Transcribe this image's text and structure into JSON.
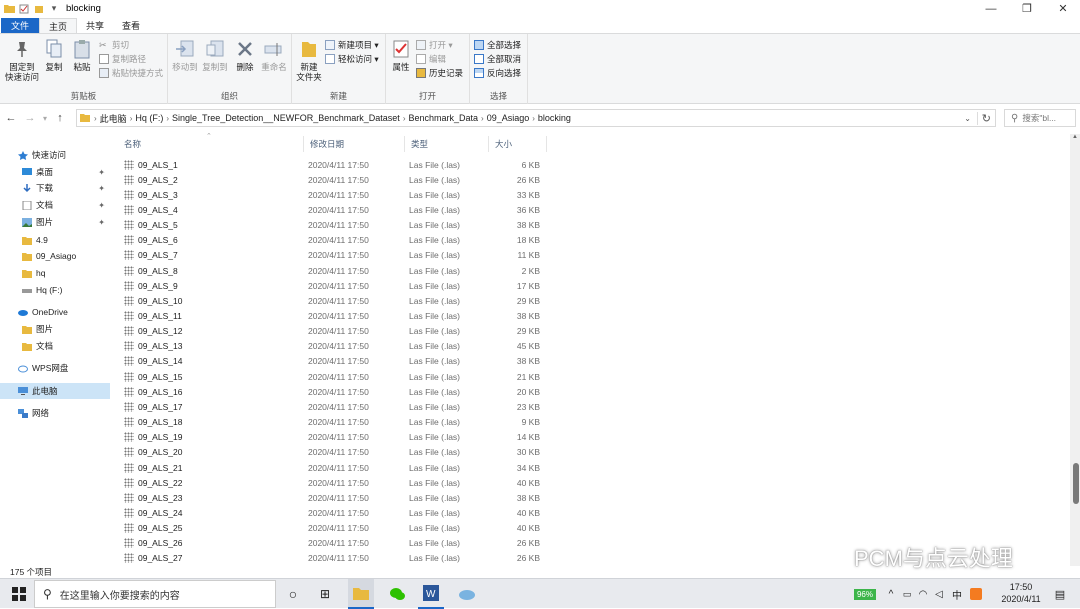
{
  "window": {
    "title": "blocking",
    "controls": {
      "minimize": "—",
      "maximize": "❐",
      "close": "✕"
    }
  },
  "tabs": [
    "文件",
    "主页",
    "共享",
    "查看"
  ],
  "ribbon": {
    "clipboard": {
      "label": "剪贴板",
      "pin": "固定到\n快速访问",
      "copy": "复制",
      "paste": "粘贴",
      "cut": "剪切",
      "copy_path": "复制路径",
      "paste_shortcut": "粘贴快捷方式"
    },
    "organize": {
      "label": "组织",
      "move_to": "移动到",
      "copy_to": "复制到",
      "delete": "删除",
      "rename": "重命名"
    },
    "new": {
      "label": "新建",
      "new_folder": "新建\n文件夹",
      "new_item": "新建项目 ▾",
      "easy_access": "轻松访问 ▾"
    },
    "open": {
      "label": "打开",
      "properties": "属性",
      "open": "打开 ▾",
      "edit": "编辑",
      "history": "历史记录"
    },
    "select": {
      "label": "选择",
      "select_all": "全部选择",
      "select_none": "全部取消",
      "invert": "反向选择"
    }
  },
  "address": {
    "crumbs": [
      "此电脑",
      "Hq (F:)",
      "Single_Tree_Detection__NEWFOR_Benchmark_Dataset",
      "Benchmark_Data",
      "09_Asiago",
      "blocking"
    ],
    "search_placeholder": "搜索\"bl..."
  },
  "nav": [
    {
      "label": "快速访问",
      "icon": "star-icon",
      "pinned": false
    },
    {
      "label": "桌面",
      "icon": "desktop-icon",
      "pinned": true
    },
    {
      "label": "下载",
      "icon": "download-icon",
      "pinned": true
    },
    {
      "label": "文档",
      "icon": "document-icon",
      "pinned": true
    },
    {
      "label": "图片",
      "icon": "picture-icon",
      "pinned": true
    },
    {
      "label": "4.9",
      "icon": "folder-icon",
      "pinned": false
    },
    {
      "label": "09_Asiago",
      "icon": "folder-icon",
      "pinned": false
    },
    {
      "label": "hq",
      "icon": "folder-icon",
      "pinned": false
    },
    {
      "label": "Hq (F:)",
      "icon": "drive-icon",
      "pinned": false
    },
    {
      "label": "OneDrive",
      "icon": "cloud-icon",
      "pinned": false
    },
    {
      "label": "图片",
      "icon": "folder-icon",
      "pinned": false
    },
    {
      "label": "文档",
      "icon": "folder-icon",
      "pinned": false
    },
    {
      "label": "WPS网盘",
      "icon": "wps-cloud-icon",
      "pinned": false
    },
    {
      "label": "此电脑",
      "icon": "computer-icon",
      "pinned": false,
      "selected": true
    },
    {
      "label": "网络",
      "icon": "network-icon",
      "pinned": false
    }
  ],
  "columns": {
    "name": "名称",
    "date": "修改日期",
    "type": "类型",
    "size": "大小"
  },
  "files": [
    {
      "name": "09_ALS_1",
      "date": "2020/4/11 17:50",
      "type": "Las File (.las)",
      "size": "6 KB"
    },
    {
      "name": "09_ALS_2",
      "date": "2020/4/11 17:50",
      "type": "Las File (.las)",
      "size": "26 KB"
    },
    {
      "name": "09_ALS_3",
      "date": "2020/4/11 17:50",
      "type": "Las File (.las)",
      "size": "33 KB"
    },
    {
      "name": "09_ALS_4",
      "date": "2020/4/11 17:50",
      "type": "Las File (.las)",
      "size": "36 KB"
    },
    {
      "name": "09_ALS_5",
      "date": "2020/4/11 17:50",
      "type": "Las File (.las)",
      "size": "38 KB"
    },
    {
      "name": "09_ALS_6",
      "date": "2020/4/11 17:50",
      "type": "Las File (.las)",
      "size": "18 KB"
    },
    {
      "name": "09_ALS_7",
      "date": "2020/4/11 17:50",
      "type": "Las File (.las)",
      "size": "11 KB"
    },
    {
      "name": "09_ALS_8",
      "date": "2020/4/11 17:50",
      "type": "Las File (.las)",
      "size": "2 KB"
    },
    {
      "name": "09_ALS_9",
      "date": "2020/4/11 17:50",
      "type": "Las File (.las)",
      "size": "17 KB"
    },
    {
      "name": "09_ALS_10",
      "date": "2020/4/11 17:50",
      "type": "Las File (.las)",
      "size": "29 KB"
    },
    {
      "name": "09_ALS_11",
      "date": "2020/4/11 17:50",
      "type": "Las File (.las)",
      "size": "38 KB"
    },
    {
      "name": "09_ALS_12",
      "date": "2020/4/11 17:50",
      "type": "Las File (.las)",
      "size": "29 KB"
    },
    {
      "name": "09_ALS_13",
      "date": "2020/4/11 17:50",
      "type": "Las File (.las)",
      "size": "45 KB"
    },
    {
      "name": "09_ALS_14",
      "date": "2020/4/11 17:50",
      "type": "Las File (.las)",
      "size": "38 KB"
    },
    {
      "name": "09_ALS_15",
      "date": "2020/4/11 17:50",
      "type": "Las File (.las)",
      "size": "21 KB"
    },
    {
      "name": "09_ALS_16",
      "date": "2020/4/11 17:50",
      "type": "Las File (.las)",
      "size": "20 KB"
    },
    {
      "name": "09_ALS_17",
      "date": "2020/4/11 17:50",
      "type": "Las File (.las)",
      "size": "23 KB"
    },
    {
      "name": "09_ALS_18",
      "date": "2020/4/11 17:50",
      "type": "Las File (.las)",
      "size": "9 KB"
    },
    {
      "name": "09_ALS_19",
      "date": "2020/4/11 17:50",
      "type": "Las File (.las)",
      "size": "14 KB"
    },
    {
      "name": "09_ALS_20",
      "date": "2020/4/11 17:50",
      "type": "Las File (.las)",
      "size": "30 KB"
    },
    {
      "name": "09_ALS_21",
      "date": "2020/4/11 17:50",
      "type": "Las File (.las)",
      "size": "34 KB"
    },
    {
      "name": "09_ALS_22",
      "date": "2020/4/11 17:50",
      "type": "Las File (.las)",
      "size": "40 KB"
    },
    {
      "name": "09_ALS_23",
      "date": "2020/4/11 17:50",
      "type": "Las File (.las)",
      "size": "38 KB"
    },
    {
      "name": "09_ALS_24",
      "date": "2020/4/11 17:50",
      "type": "Las File (.las)",
      "size": "40 KB"
    },
    {
      "name": "09_ALS_25",
      "date": "2020/4/11 17:50",
      "type": "Las File (.las)",
      "size": "40 KB"
    },
    {
      "name": "09_ALS_26",
      "date": "2020/4/11 17:50",
      "type": "Las File (.las)",
      "size": "26 KB"
    },
    {
      "name": "09_ALS_27",
      "date": "2020/4/11 17:50",
      "type": "Las File (.las)",
      "size": "26 KB"
    }
  ],
  "status": {
    "item_count": "175 个项目"
  },
  "watermark": "PCM与点云处理",
  "taskbar": {
    "search_placeholder": "在这里输入你要搜索的内容",
    "battery": "96%",
    "ime": "中",
    "time": "17:50",
    "date": "2020/4/11"
  },
  "colors": {
    "accent": "#1b67c7",
    "selected": "#cce4f7",
    "folder": "#e8b93f"
  }
}
